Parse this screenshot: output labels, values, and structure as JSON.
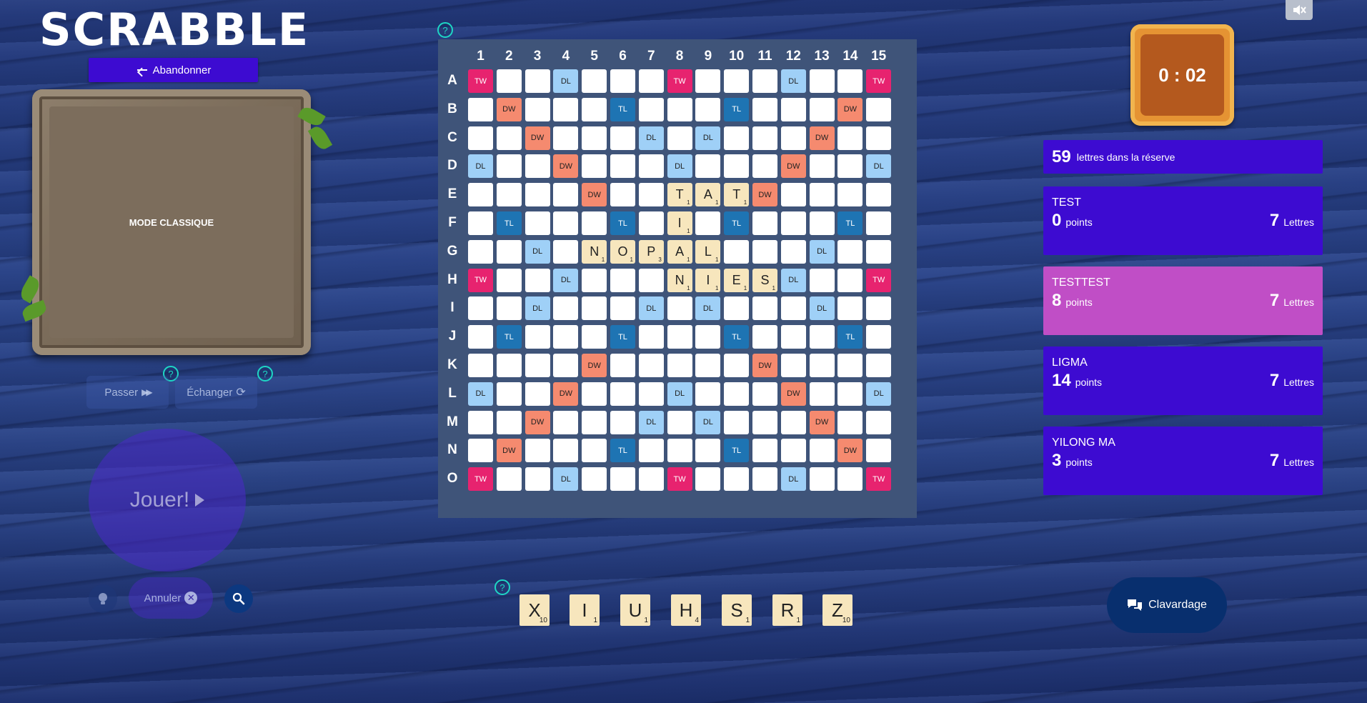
{
  "logo": {
    "text": "SCRABBLE"
  },
  "controls": {
    "abandon_label": "Abandonner",
    "mode_label": "MODE CLASSIQUE",
    "pass_label": "Passer",
    "exchange_label": "Échanger",
    "play_label": "Jouer!",
    "cancel_label": "Annuler",
    "help_glyph": "?"
  },
  "timer": {
    "value": "0 : 02"
  },
  "reserve": {
    "count": "59",
    "label": "lettres dans la réserve"
  },
  "players": [
    {
      "name": "TEST",
      "points": "0",
      "points_label": "points",
      "letters": "7",
      "letters_label": "Lettres",
      "active": false
    },
    {
      "name": "TESTTEST",
      "points": "8",
      "points_label": "points",
      "letters": "7",
      "letters_label": "Lettres",
      "active": true
    },
    {
      "name": "LIGMA",
      "points": "14",
      "points_label": "points",
      "letters": "7",
      "letters_label": "Lettres",
      "active": false
    },
    {
      "name": "YILONG MA",
      "points": "3",
      "points_label": "points",
      "letters": "7",
      "letters_label": "Lettres",
      "active": false
    }
  ],
  "board": {
    "columns": [
      "1",
      "2",
      "3",
      "4",
      "5",
      "6",
      "7",
      "8",
      "9",
      "10",
      "11",
      "12",
      "13",
      "14",
      "15"
    ],
    "rows": [
      "A",
      "B",
      "C",
      "D",
      "E",
      "F",
      "G",
      "H",
      "I",
      "J",
      "K",
      "L",
      "M",
      "N",
      "O"
    ],
    "bonus": [
      [
        "TW",
        "",
        "",
        "DL",
        "",
        "",
        "",
        "TW",
        "",
        "",
        "",
        "DL",
        "",
        "",
        "TW"
      ],
      [
        "",
        "DW",
        "",
        "",
        "",
        "TL",
        "",
        "",
        "",
        "TL",
        "",
        "",
        "",
        "DW",
        ""
      ],
      [
        "",
        "",
        "DW",
        "",
        "",
        "",
        "DL",
        "",
        "DL",
        "",
        "",
        "",
        "DW",
        "",
        ""
      ],
      [
        "DL",
        "",
        "",
        "DW",
        "",
        "",
        "",
        "DL",
        "",
        "",
        "",
        "DW",
        "",
        "",
        "DL"
      ],
      [
        "",
        "",
        "",
        "",
        "DW",
        "",
        "",
        "",
        "",
        "",
        "DW",
        "",
        "",
        "",
        ""
      ],
      [
        "",
        "TL",
        "",
        "",
        "",
        "TL",
        "",
        "",
        "",
        "TL",
        "",
        "",
        "",
        "TL",
        ""
      ],
      [
        "",
        "",
        "DL",
        "",
        "",
        "",
        "DL",
        "",
        "DL",
        "",
        "",
        "",
        "DL",
        "",
        ""
      ],
      [
        "TW",
        "",
        "",
        "DL",
        "",
        "",
        "",
        "DW",
        "",
        "",
        "",
        "DL",
        "",
        "",
        "TW"
      ],
      [
        "",
        "",
        "DL",
        "",
        "",
        "",
        "DL",
        "",
        "DL",
        "",
        "",
        "",
        "DL",
        "",
        ""
      ],
      [
        "",
        "TL",
        "",
        "",
        "",
        "TL",
        "",
        "",
        "",
        "TL",
        "",
        "",
        "",
        "TL",
        ""
      ],
      [
        "",
        "",
        "",
        "",
        "DW",
        "",
        "",
        "",
        "",
        "",
        "DW",
        "",
        "",
        "",
        ""
      ],
      [
        "DL",
        "",
        "",
        "DW",
        "",
        "",
        "",
        "DL",
        "",
        "",
        "",
        "DW",
        "",
        "",
        "DL"
      ],
      [
        "",
        "",
        "DW",
        "",
        "",
        "",
        "DL",
        "",
        "DL",
        "",
        "",
        "",
        "DW",
        "",
        ""
      ],
      [
        "",
        "DW",
        "",
        "",
        "",
        "TL",
        "",
        "",
        "",
        "TL",
        "",
        "",
        "",
        "DW",
        ""
      ],
      [
        "TW",
        "",
        "",
        "DL",
        "",
        "",
        "",
        "TW",
        "",
        "",
        "",
        "DL",
        "",
        "",
        "TW"
      ]
    ],
    "tiles": [
      {
        "row": 4,
        "col": 7,
        "letter": "T",
        "value": "1"
      },
      {
        "row": 4,
        "col": 8,
        "letter": "A",
        "value": "1"
      },
      {
        "row": 4,
        "col": 9,
        "letter": "T",
        "value": "1"
      },
      {
        "row": 5,
        "col": 7,
        "letter": "I",
        "value": "1"
      },
      {
        "row": 6,
        "col": 4,
        "letter": "N",
        "value": "1"
      },
      {
        "row": 6,
        "col": 5,
        "letter": "O",
        "value": "1"
      },
      {
        "row": 6,
        "col": 6,
        "letter": "P",
        "value": "3"
      },
      {
        "row": 6,
        "col": 7,
        "letter": "A",
        "value": "1"
      },
      {
        "row": 6,
        "col": 8,
        "letter": "L",
        "value": "1"
      },
      {
        "row": 7,
        "col": 7,
        "letter": "N",
        "value": "1"
      },
      {
        "row": 7,
        "col": 8,
        "letter": "I",
        "value": "1"
      },
      {
        "row": 7,
        "col": 9,
        "letter": "E",
        "value": "1"
      },
      {
        "row": 7,
        "col": 10,
        "letter": "S",
        "value": "1"
      }
    ]
  },
  "rack": [
    {
      "letter": "X",
      "value": "10"
    },
    {
      "letter": "I",
      "value": "1"
    },
    {
      "letter": "U",
      "value": "1"
    },
    {
      "letter": "H",
      "value": "4"
    },
    {
      "letter": "S",
      "value": "1"
    },
    {
      "letter": "R",
      "value": "1"
    },
    {
      "letter": "Z",
      "value": "10"
    }
  ],
  "chat": {
    "label": "Clavardage"
  }
}
